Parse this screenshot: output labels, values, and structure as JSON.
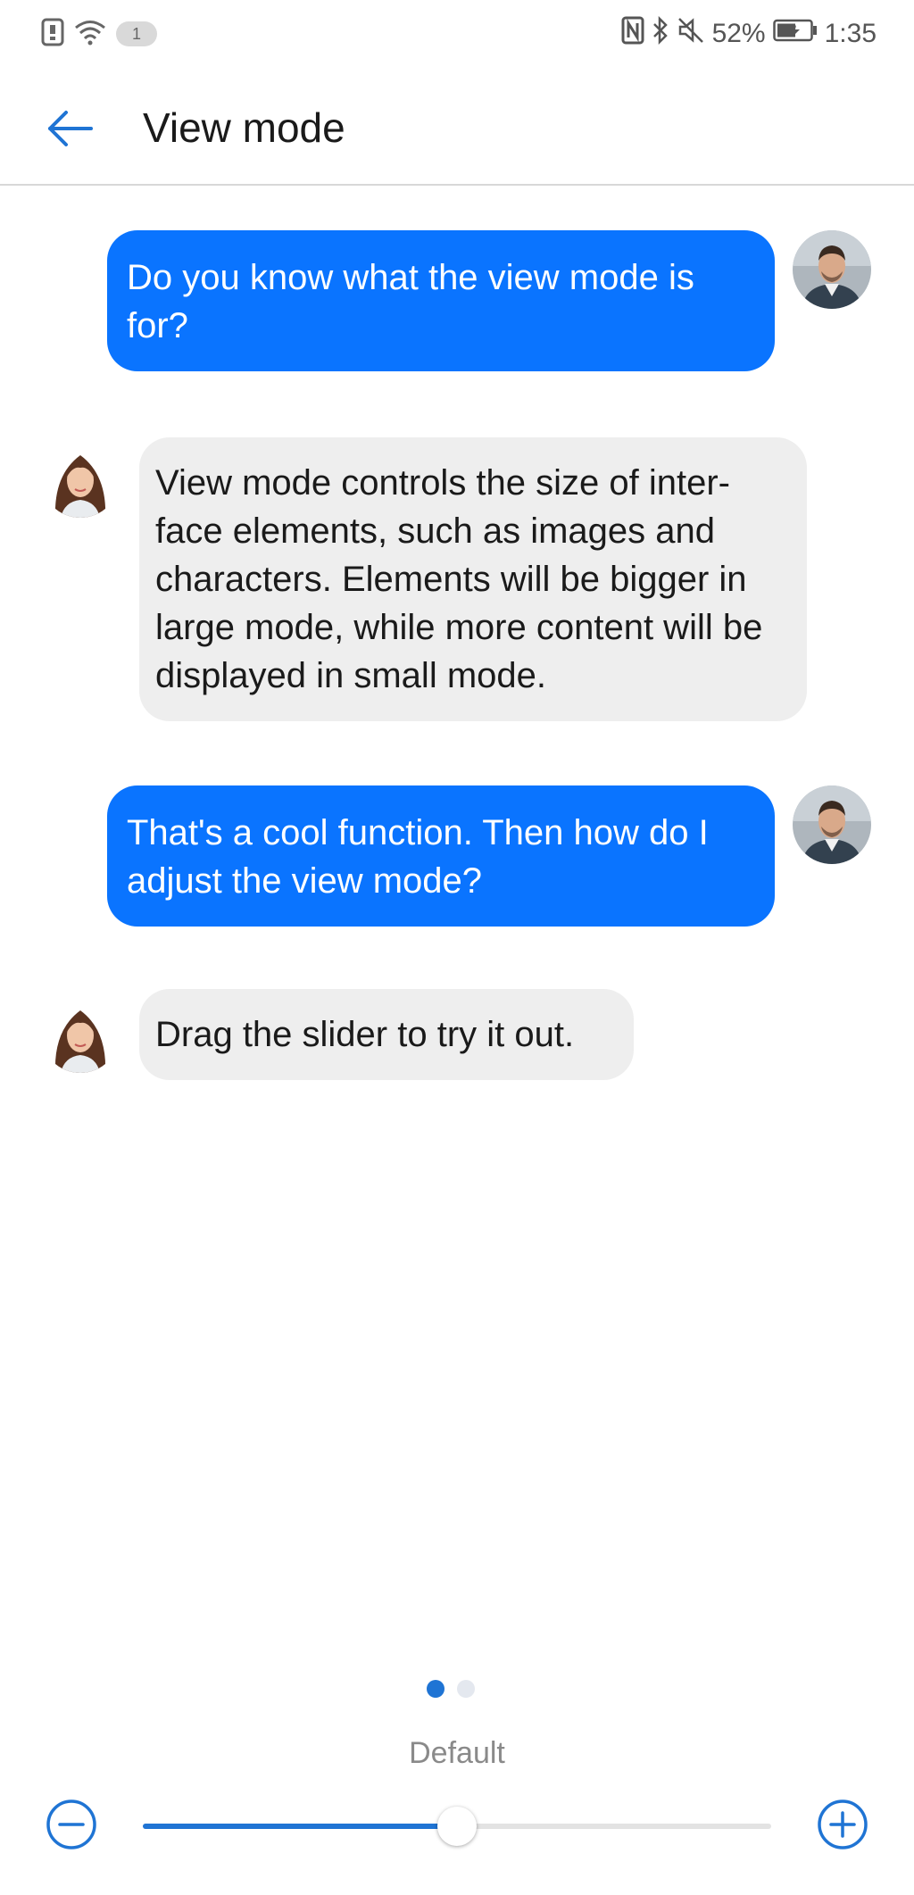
{
  "status_bar": {
    "left_icons": [
      "sim-icon",
      "wifi-icon"
    ],
    "notification_count": "1",
    "battery_percent": "52%",
    "time": "1:35"
  },
  "header": {
    "title": "View mode"
  },
  "messages": [
    {
      "from": "user",
      "text": "Do you know what the view mode is for?"
    },
    {
      "from": "assistant",
      "text": "View mode controls the size of inter-face elements, such as images and characters. Elements will be bigger in large mode, while more content will be displayed in small mode."
    },
    {
      "from": "user",
      "text": "That's a cool function. Then how do I adjust the view mode?"
    },
    {
      "from": "assistant",
      "text": "Drag the slider to try it out."
    }
  ],
  "view_mode": {
    "label": "Default",
    "slider_level": 0.5,
    "page_index": 1,
    "page_count": 2
  },
  "colors": {
    "accent": "#1f74d4",
    "user_bubble": "#0a74ff",
    "bot_bubble": "#eeeeee"
  }
}
